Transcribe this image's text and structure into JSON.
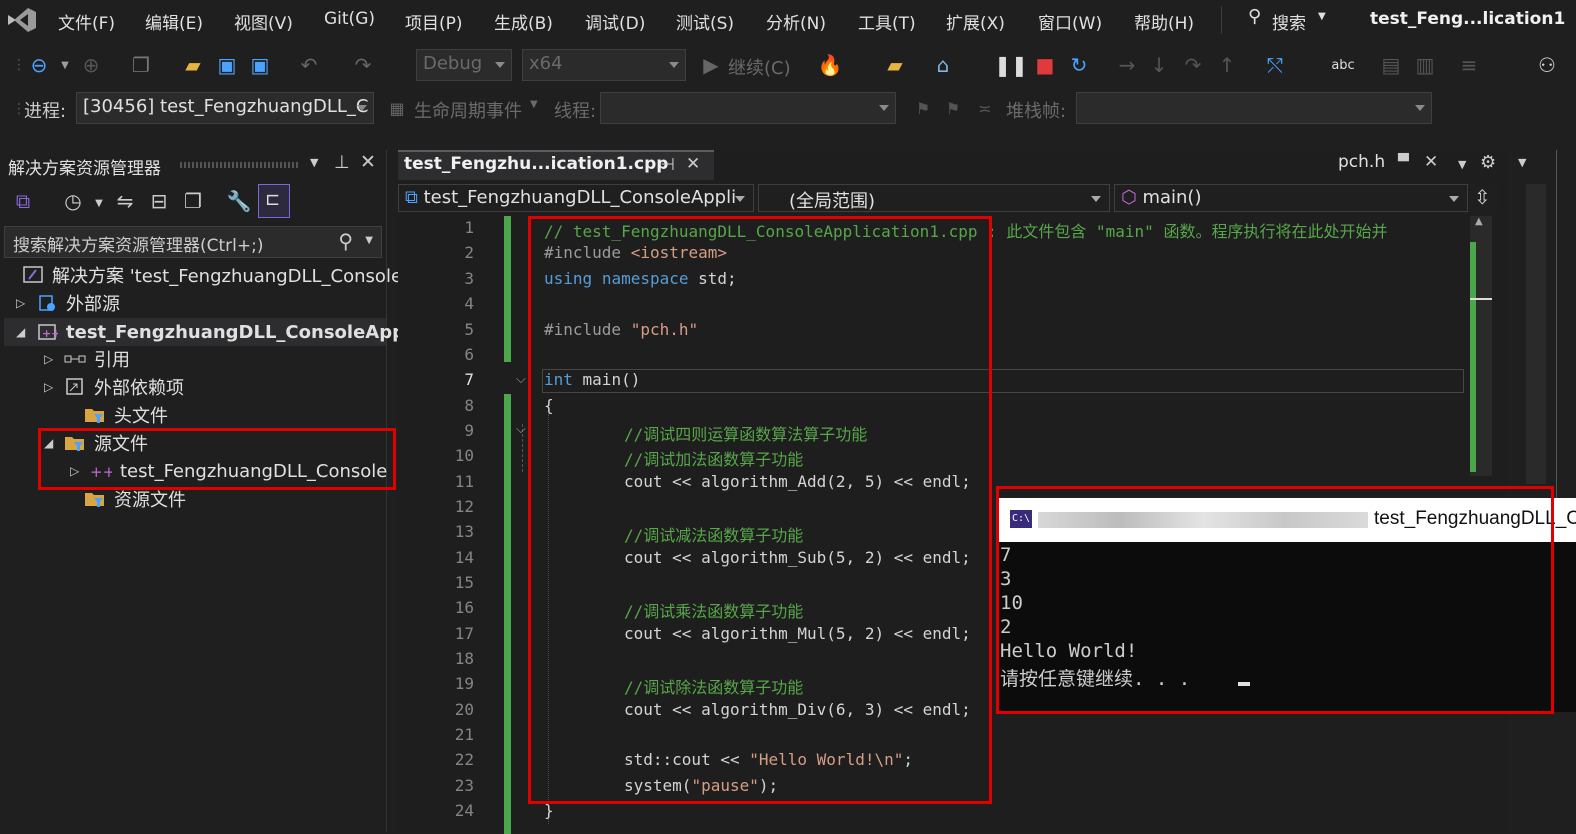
{
  "menu": {
    "items": [
      "文件(F)",
      "编辑(E)",
      "视图(V)",
      "Git(G)",
      "项目(P)",
      "生成(B)",
      "调试(D)",
      "测试(S)",
      "分析(N)",
      "工具(T)",
      "扩展(X)",
      "窗口(W)",
      "帮助(H)"
    ],
    "search_label": "搜索",
    "window_title": "test_Feng...lication1"
  },
  "toolbar1": {
    "config_value": "Debug",
    "platform_value": "x64",
    "continue_label": "继续(C)"
  },
  "toolbar2": {
    "process_label": "进程:",
    "process_value": "[30456] test_FengzhuangDLL_C",
    "lifecycle_label": "生命周期事件",
    "thread_label": "线程:",
    "stackframe_label": "堆栈帧:"
  },
  "solution_explorer": {
    "title": "解决方案资源管理器",
    "search_placeholder": "搜索解决方案资源管理器(Ctrl+;)",
    "tree": [
      {
        "label": "解决方案 'test_FengzhuangDLL_Console",
        "toggle": "",
        "bold": false
      },
      {
        "label": "外部源",
        "toggle": "▷",
        "bold": false
      },
      {
        "label": "test_FengzhuangDLL_ConsoleApp",
        "toggle": "◢",
        "bold": true
      },
      {
        "label": "引用",
        "toggle": "▷",
        "bold": false
      },
      {
        "label": "外部依赖项",
        "toggle": "▷",
        "bold": false
      },
      {
        "label": "头文件",
        "toggle": "",
        "bold": false
      },
      {
        "label": "源文件",
        "toggle": "◢",
        "bold": false
      },
      {
        "label": "test_FengzhuangDLL_Console",
        "toggle": "▷",
        "bold": false
      },
      {
        "label": "资源文件",
        "toggle": "",
        "bold": false
      }
    ]
  },
  "editor": {
    "active_tab": "test_Fengzhu...ication1.cpp",
    "second_tab": "pch.h",
    "nav_project": "test_FengzhuangDLL_ConsoleAppli",
    "nav_scope": "(全局范围)",
    "nav_member": "main()",
    "line_numbers": [
      "1",
      "2",
      "3",
      "4",
      "5",
      "6",
      "7",
      "8",
      "9",
      "10",
      "11",
      "12",
      "13",
      "14",
      "15",
      "16",
      "17",
      "18",
      "19",
      "20",
      "21",
      "22",
      "23",
      "24"
    ],
    "code": {
      "l1": "// test_FengzhuangDLL_ConsoleApplication1.cpp : 此文件包含 \"main\" 函数。程序执行将在此处开始并",
      "l2_pp": "#include ",
      "l2_inc": "<iostream>",
      "l3_kw1": "using",
      "l3_kw2": "namespace",
      "l3_rest": " std;",
      "l5_pp": "#include ",
      "l5_str": "\"pch.h\"",
      "l7_kw": "int",
      "l7_rest": " main()",
      "l8": "{",
      "l9": "//调试四则运算函数算法算子功能",
      "l10": "//调试加法函数算子功能",
      "l11": "cout << algorithm_Add(2, 5) << endl;",
      "l13": "//调试减法函数算子功能",
      "l14": "cout << algorithm_Sub(5, 2) << endl;",
      "l16": "//调试乘法函数算子功能",
      "l17": "cout << algorithm_Mul(5, 2) << endl;",
      "l19": "//调试除法函数算子功能",
      "l20": "cout << algorithm_Div(6, 3) << endl;",
      "l22_a": "std::cout << ",
      "l22_str": "\"Hello World!\\n\"",
      "l22_b": ";",
      "l23_a": "system(",
      "l23_str": "\"pause\"",
      "l23_b": ");",
      "l24": "}"
    }
  },
  "console": {
    "title_icon": "C:\\",
    "title_suffix": "test_FengzhuangDLL_C",
    "output": [
      "7",
      "3",
      "10",
      "2",
      "Hello World!",
      "请按任意键继续. . . "
    ]
  },
  "colors": {
    "accent_red": "#e00000",
    "git_bar": "#4ca64c",
    "keyword": "#569cd6",
    "comment": "#57a64a"
  }
}
